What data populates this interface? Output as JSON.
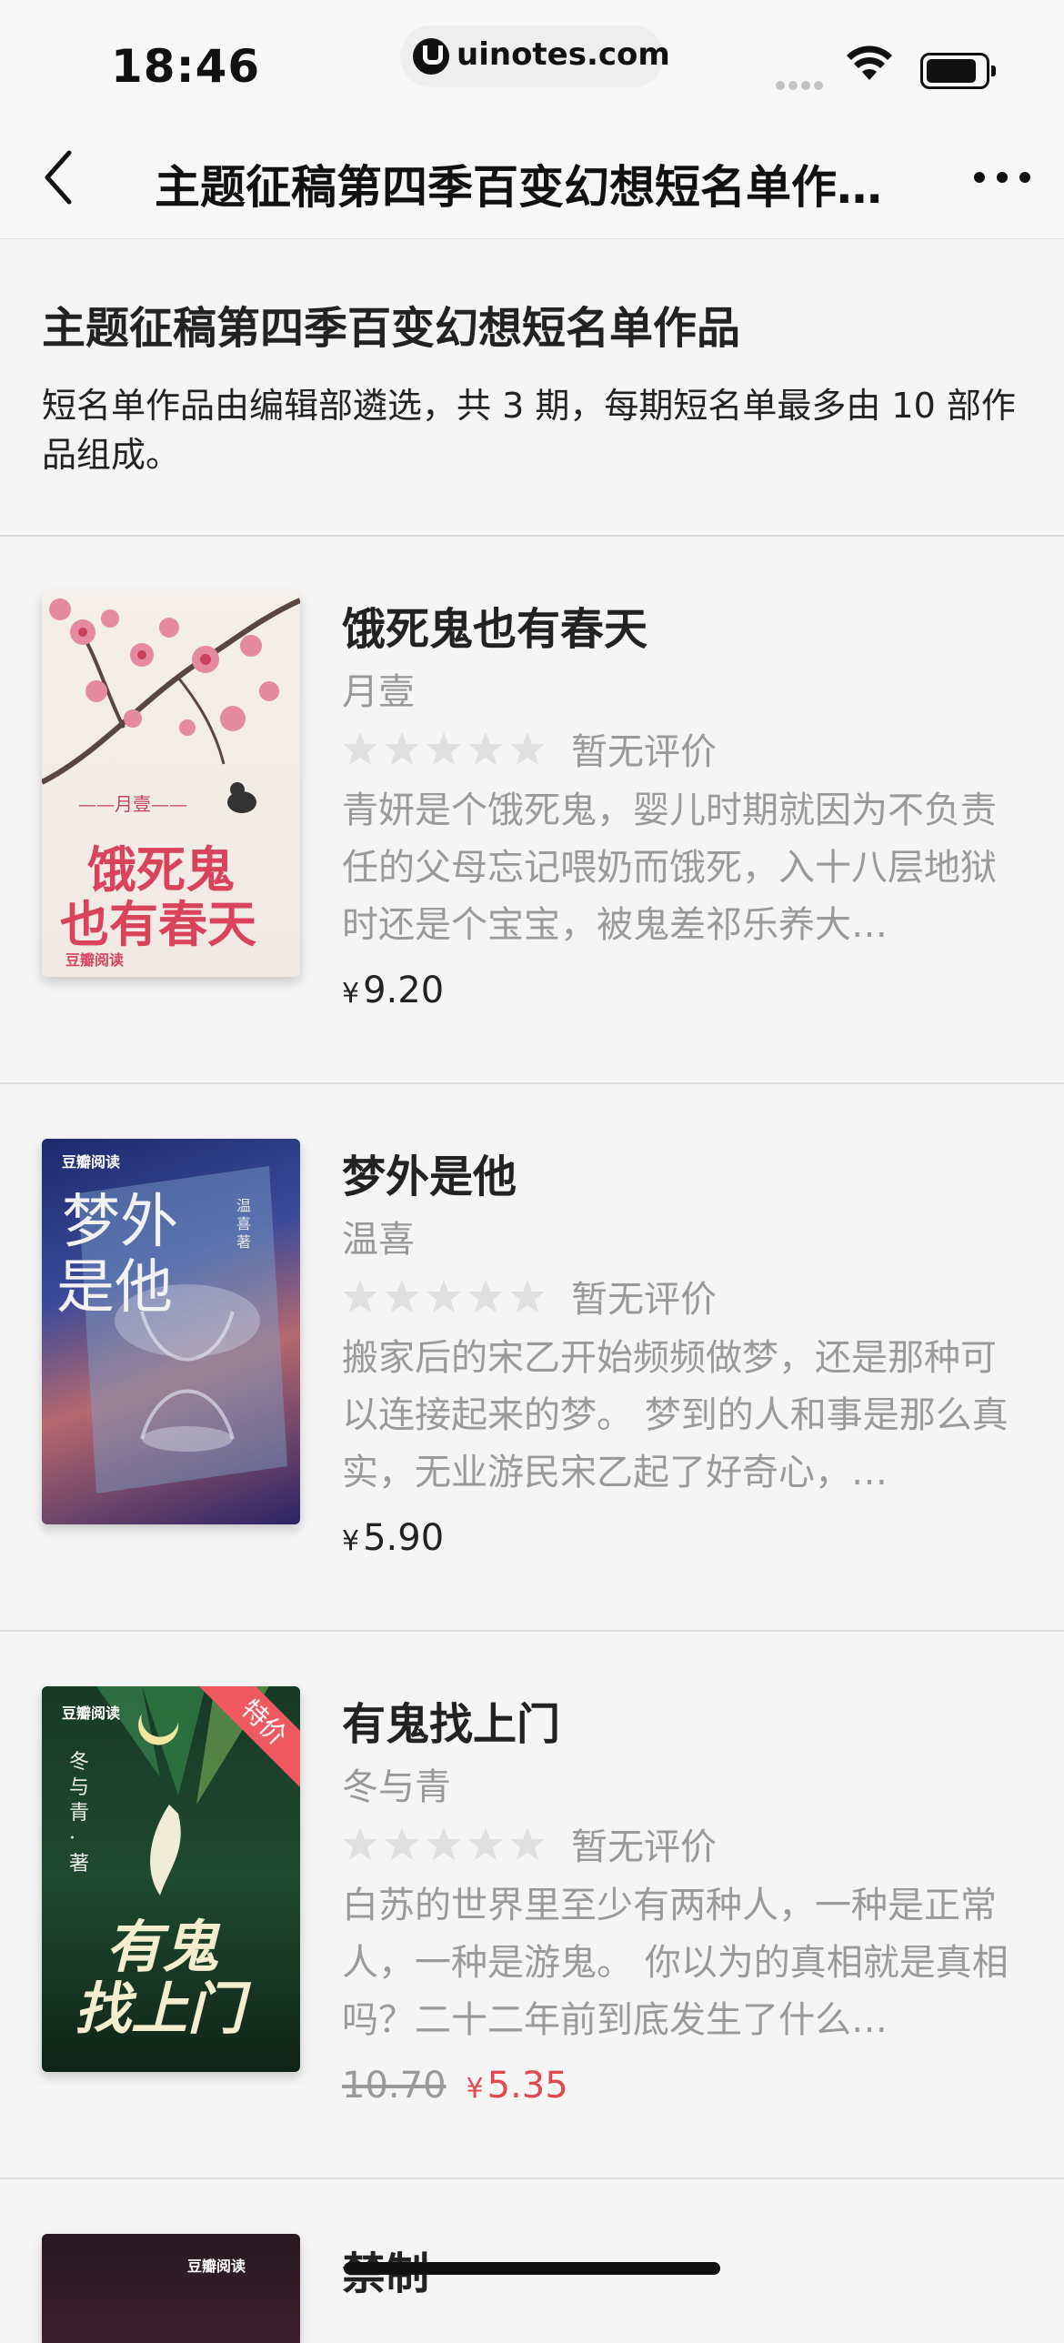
{
  "status_bar": {
    "time": "18:46",
    "url": "uinotes.com"
  },
  "nav": {
    "title": "主题征稿第四季百变幻想短名单作…",
    "back_icon": "chevron-left-icon",
    "more_icon": "more-dots-icon"
  },
  "header": {
    "title": "主题征稿第四季百变幻想短名单作品",
    "description": "短名单作品由编辑部遴选，共 3 期，每期短名单最多由 10 部作品组成。"
  },
  "books": [
    {
      "title": "饿死鬼也有春天",
      "author": "月壹",
      "rating_text": "暂无评价",
      "rating_value": 0,
      "description": "青妍是个饿死鬼，婴儿时期就因为不负责任的父母忘记喂奶而饿死，入十八层地狱时还是个宝宝，被鬼差祁乐养大…",
      "currency": "¥",
      "price": "9.20",
      "cover": {
        "title_line1": "饿死鬼",
        "title_line2": "也有春天",
        "author_tag": "——月壹——",
        "publisher": "豆瓣阅读"
      }
    },
    {
      "title": "梦外是他",
      "author": "温喜",
      "rating_text": "暂无评价",
      "rating_value": 0,
      "description": "搬家后的宋乙开始频频做梦，还是那种可以连接起来的梦。 梦到的人和事是那么真实，无业游民宋乙起了好奇心，…",
      "currency": "¥",
      "price": "5.90",
      "cover": {
        "title_line1": "梦外",
        "title_line2": "是他",
        "author_tag": "温喜 著",
        "publisher": "豆瓣阅读"
      }
    },
    {
      "title": "有鬼找上门",
      "author": "冬与青",
      "rating_text": "暂无评价",
      "rating_value": 0,
      "description": "白苏的世界里至少有两种人，一种是正常人，一种是游鬼。 你以为的真相就是真相吗？二十二年前到底发生了什么…",
      "currency": "¥",
      "old_price": "10.70",
      "price": "5.35",
      "cover": {
        "title_line1": "有鬼",
        "title_line2": "找上门",
        "author_tag": "冬与青 · 著",
        "publisher": "豆瓣阅读",
        "badge": "特价"
      }
    },
    {
      "title": "禁制",
      "cover": {
        "publisher": "豆瓣阅读"
      }
    }
  ],
  "colors": {
    "accent_red": "#e0494f",
    "muted": "#999999"
  }
}
